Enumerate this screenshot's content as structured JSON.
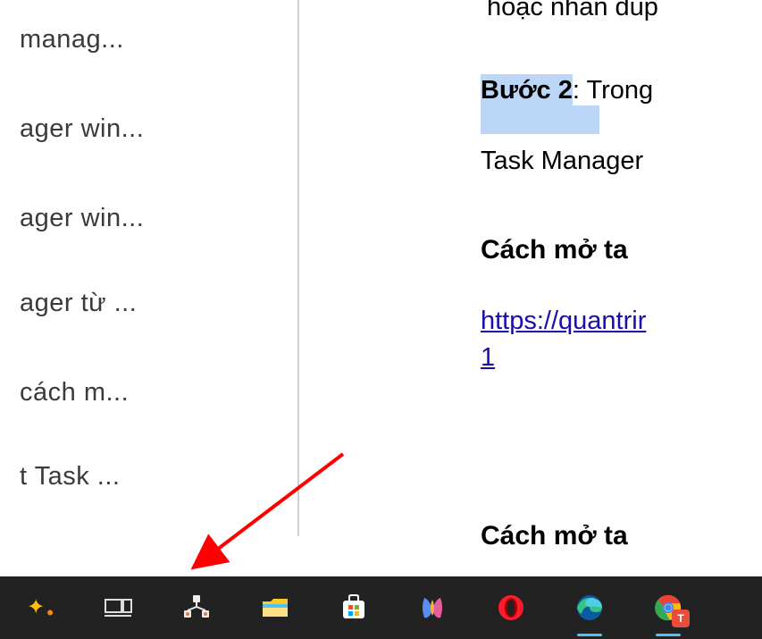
{
  "sidebar": {
    "items": [
      {
        "label": " manag..."
      },
      {
        "label": "ager win..."
      },
      {
        "label": "ager win..."
      },
      {
        "label": "ager từ ..."
      },
      {
        "label": " cách m..."
      },
      {
        "label": "t Task ..."
      }
    ]
  },
  "content": {
    "top_truncated": "hoặc nhấn đúp",
    "step_bold": "Bước 2",
    "step_rest": ": Trong",
    "task_manager": "Task Manager",
    "heading1": "Cách mở ta",
    "link_line1": "https://quantrir",
    "link_line2": "1",
    "link_href": "#",
    "heading2": "Cách mở ta"
  },
  "taskbar": {
    "chrome_badge": "T"
  }
}
